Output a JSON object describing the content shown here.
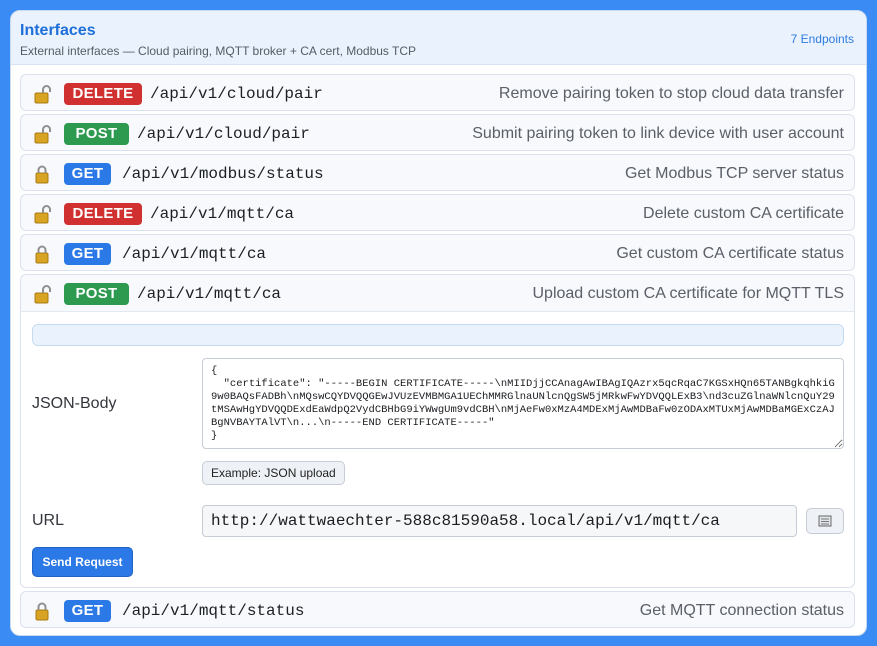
{
  "header": {
    "title": "Interfaces",
    "subtitle": "External interfaces — Cloud pairing, MQTT broker + CA cert, Modbus TCP",
    "count": "7 Endpoints"
  },
  "endpoints": [
    {
      "method": "DELETE",
      "path": "/api/v1/cloud/pair",
      "description": "Remove pairing token to stop cloud data transfer",
      "lock_icon": "lock-open-icon"
    },
    {
      "method": "POST",
      "path": "/api/v1/cloud/pair",
      "description": "Submit pairing token to link device with user account",
      "lock_icon": "lock-open-icon"
    },
    {
      "method": "GET",
      "path": "/api/v1/modbus/status",
      "description": "Get Modbus TCP server status",
      "lock_icon": "lock-closed-icon"
    },
    {
      "method": "DELETE",
      "path": "/api/v1/mqtt/ca",
      "description": "Delete custom CA certificate",
      "lock_icon": "lock-open-icon"
    },
    {
      "method": "GET",
      "path": "/api/v1/mqtt/ca",
      "description": "Get custom CA certificate status",
      "lock_icon": "lock-closed-icon"
    },
    {
      "method": "POST",
      "path": "/api/v1/mqtt/ca",
      "description": "Upload custom CA certificate for MQTT TLS",
      "lock_icon": "lock-open-icon"
    },
    {
      "method": "GET",
      "path": "/api/v1/mqtt/status",
      "description": "Get MQTT connection status",
      "lock_icon": "lock-closed-icon"
    }
  ],
  "request_panel": {
    "json_label": "JSON-Body",
    "json_body": "{\n  \"certificate\": \"-----BEGIN CERTIFICATE-----\\nMIIDjjCCAnagAwIBAgIQAzrx5qcRqaC7KGSxHQn65TANBgkqhkiG9w0BAQsFADBh\\nMQswCQYDVQQGEwJVUzEVMBMGA1UEChMMRGlnaUNlcnQgSW5jMRkwFwYDVQQLExB3\\nd3cuZGlnaWNlcnQuY29tMSAwHgYDVQQDExdEaWdpQ2VydCBHbG9iYWwgUm9vdCBH\\nMjAeFw0xMzA4MDExMjAwMDBaFw0zODAxMTUxMjAwMDBaMGExCzAJBgNVBAYTAlVT\\n...\\n-----END CERTIFICATE-----\"\n}",
    "example_button": "Example: JSON upload",
    "url_label": "URL",
    "url_value": "http://wattwaechter-588c81590a58.local/api/v1/mqtt/ca",
    "send_button": "Send Request"
  },
  "colors": {
    "background": "#3b8bf5",
    "delete": "#d0302f",
    "post": "#2e9a4f",
    "get": "#2a79e6",
    "accent": "#1e6fd9"
  }
}
